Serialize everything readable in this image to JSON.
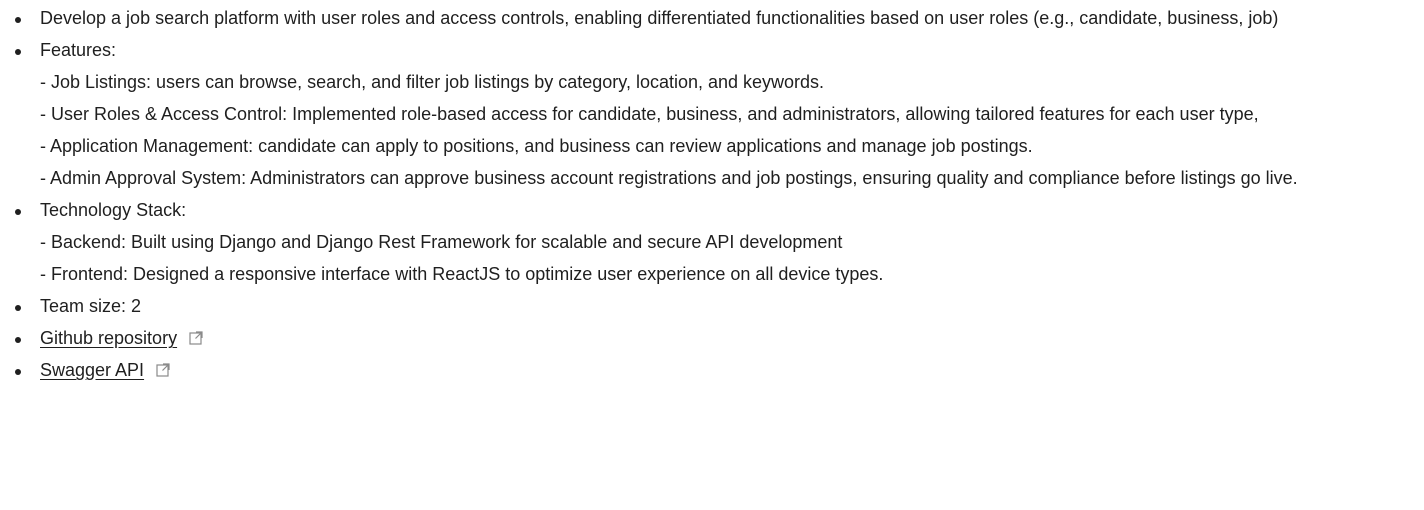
{
  "items": {
    "intro": "Develop a job search platform with user roles and access controls, enabling differentiated functionalities based on user roles (e.g., candidate, business, job)",
    "features_title": "Features:",
    "features": [
      "- Job Listings: users can browse, search, and filter job listings by category, location, and keywords.",
      "- User Roles & Access Control: Implemented role-based access for candidate, business, and administrators, allowing tailored features for each user type,",
      "- Application Management: candidate can apply to positions, and business can review applications and manage job postings.",
      "- Admin Approval System: Administrators can approve business account registrations and job postings, ensuring quality and compliance before listings go live."
    ],
    "tech_title": "Technology Stack:",
    "tech": [
      "- Backend: Built using Django and Django Rest Framework for scalable and secure API development",
      "- Frontend: Designed a responsive interface with ReactJS to optimize user experience on all device types."
    ],
    "team": "Team size: 2",
    "github_link": "Github repository",
    "swagger_link": "Swagger API"
  },
  "icons": {
    "external": "external-link-icon"
  },
  "colors": {
    "text": "#1f1f1f",
    "icon": "#8a8a8a"
  }
}
